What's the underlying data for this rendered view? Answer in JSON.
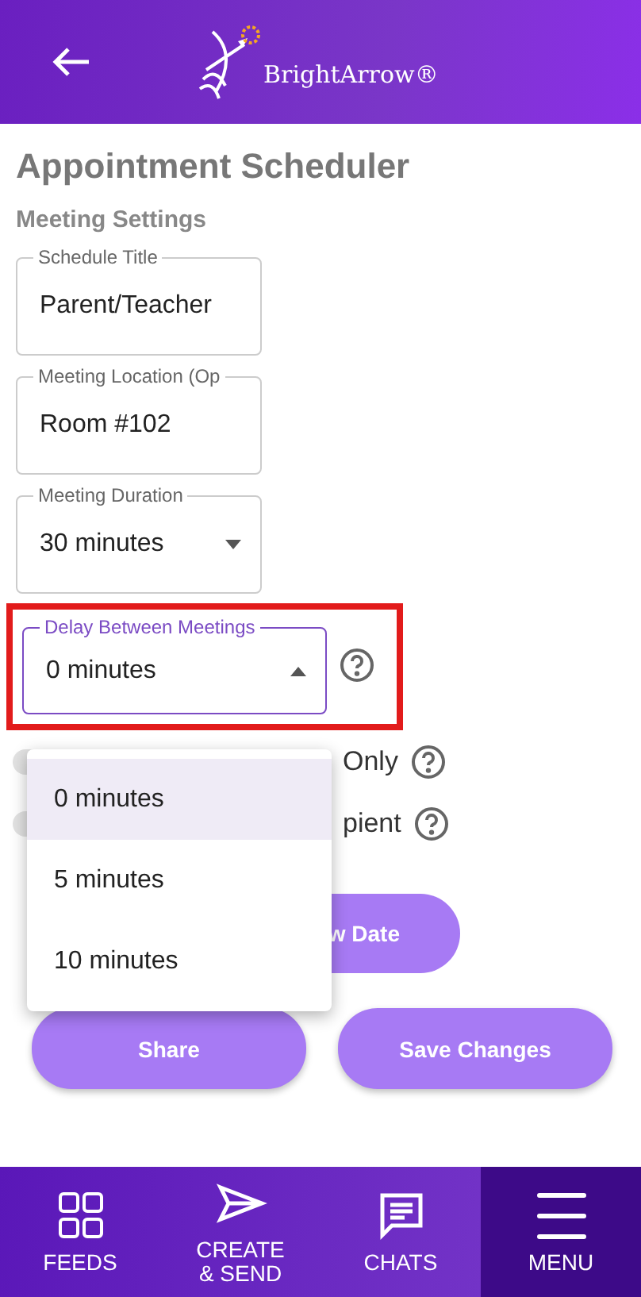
{
  "header": {
    "logo_text": "BrightArrow®"
  },
  "title": "Appointment Scheduler",
  "section": "Meeting Settings",
  "fields": [
    {
      "label": "Schedule Title",
      "value": "Parent/Teacher",
      "kind": "text"
    },
    {
      "label": "Meeting Location (Op",
      "value": "Room #102",
      "kind": "text"
    },
    {
      "label": "Meeting Duration",
      "value": "30 minutes",
      "kind": "select",
      "expanded": false
    }
  ],
  "delay_field": {
    "label": "Delay Between Meetings",
    "value": "0 minutes",
    "expanded": true,
    "highlighted": true,
    "options": [
      {
        "label": "0 minutes",
        "selected": true
      },
      {
        "label": "5 minutes",
        "selected": false
      },
      {
        "label": "10 minutes",
        "selected": false
      }
    ]
  },
  "toggles": [
    {
      "label": "Only",
      "on": false
    },
    {
      "label": "pient",
      "on": false
    }
  ],
  "date_button": "w Date",
  "buttons": [
    "Share",
    "Save Changes"
  ],
  "nav": [
    {
      "label": "FEEDS",
      "kind": "grid",
      "selected": false
    },
    {
      "label": "CREATE\n& SEND",
      "kind": "send",
      "selected": false
    },
    {
      "label": "CHATS",
      "kind": "chat",
      "selected": false
    },
    {
      "label": "MENU",
      "kind": "menu",
      "selected": true
    }
  ]
}
